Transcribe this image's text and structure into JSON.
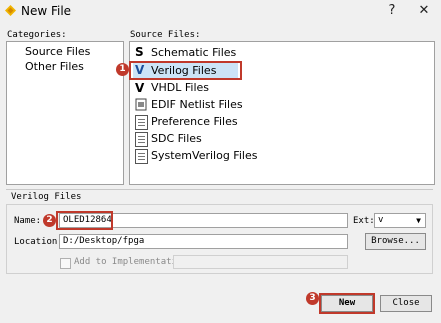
{
  "window": {
    "title": "New File",
    "help": "?",
    "close": "✕"
  },
  "categories": {
    "label": "Categories:",
    "items": [
      "Source Files",
      "Other Files"
    ]
  },
  "source_files": {
    "label": "Source Files:",
    "items": [
      "Schematic Files",
      "Verilog Files",
      "VHDL Files",
      "EDIF Netlist Files",
      "Preference Files",
      "SDC Files",
      "SystemVerilog Files"
    ],
    "selected": "Verilog Files"
  },
  "verilog_files": {
    "section_label": "Verilog Files",
    "name_label": "Name:",
    "name_value": "OLED12864",
    "ext_label": "Ext:",
    "ext_value": "v",
    "location_label": "Location:",
    "location_value": "D:/Desktop/fpga",
    "browse_label": "Browse...",
    "add_impl_label": "Add to Implementation"
  },
  "buttons": {
    "new": "New",
    "close": "Close"
  },
  "callouts": [
    "1",
    "2",
    "3"
  ]
}
